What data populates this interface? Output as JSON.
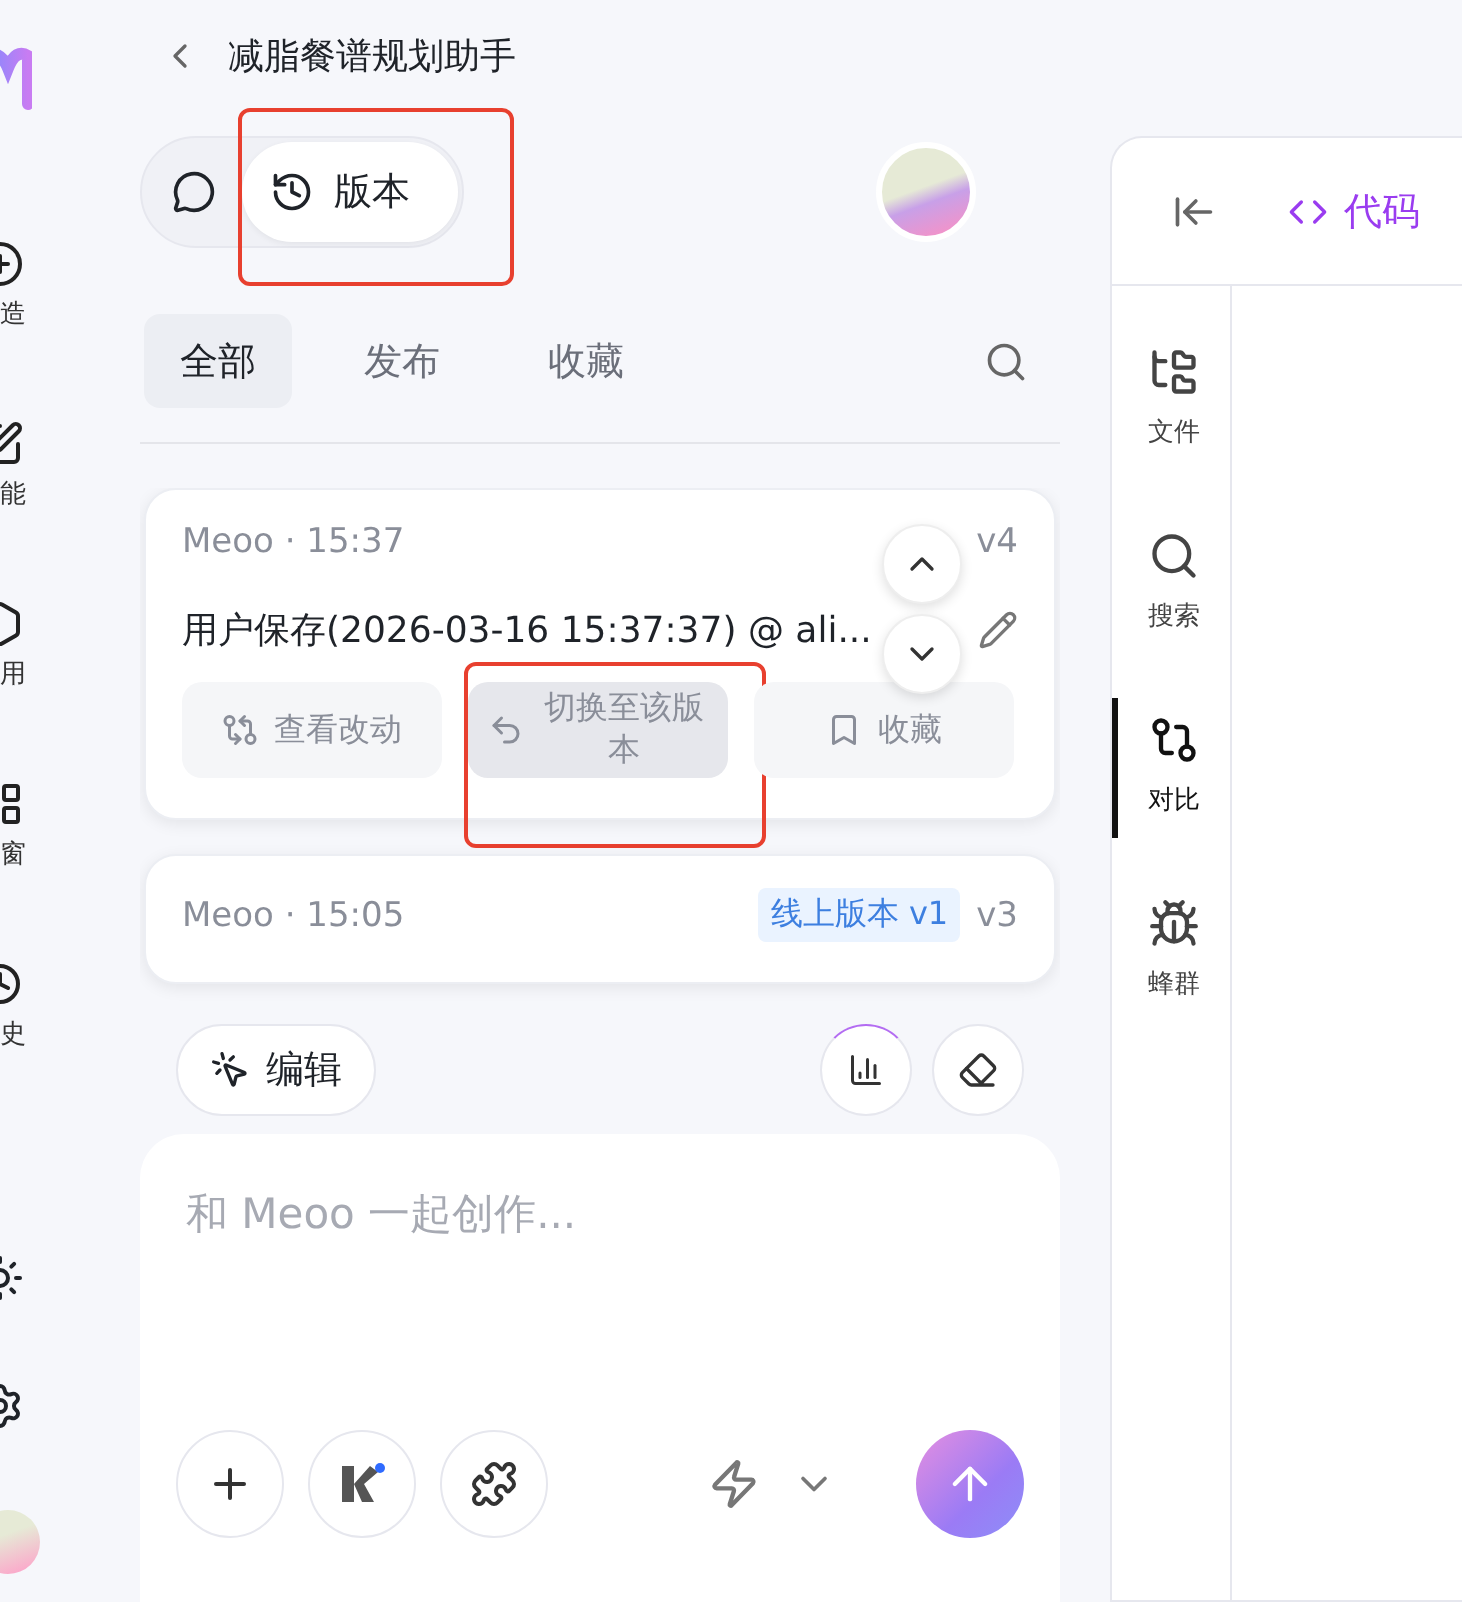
{
  "sidebar": {
    "items": [
      {
        "kind": "create",
        "label": "造"
      },
      {
        "kind": "skills",
        "label": "能"
      },
      {
        "kind": "apps",
        "label": "用"
      },
      {
        "kind": "windows",
        "label": "窗"
      },
      {
        "kind": "history",
        "label": "史"
      }
    ]
  },
  "header": {
    "title": "减脂餐谱规划助手"
  },
  "view_switch": [
    {
      "kind": "chat",
      "selected": false,
      "highlighted": false
    },
    {
      "kind": "versions",
      "label": "版本",
      "selected": true,
      "highlighted": true
    }
  ],
  "filter_tabs": [
    {
      "label": "全部",
      "selected": true
    },
    {
      "label": "发布",
      "selected": false
    },
    {
      "label": "收藏",
      "selected": false
    }
  ],
  "versions": [
    {
      "meta": "Meoo · 15:37",
      "version": "v4",
      "title": "用户保存(2026-03-16 15:37:37) @ ali...",
      "actions": [
        {
          "kind": "diff",
          "label": "查看改动",
          "highlighted": false
        },
        {
          "kind": "restore",
          "label": "切换至该版本",
          "highlighted": true
        },
        {
          "kind": "bookmark",
          "label": "收藏",
          "highlighted": false
        }
      ]
    },
    {
      "meta": "Meoo · 15:05",
      "badge": "线上版本 v1",
      "version": "v3"
    }
  ],
  "toolbar": {
    "edit": "编辑"
  },
  "composer": {
    "placeholder": "和 Meoo 一起创作..."
  },
  "code_panel": {
    "tab": "代码",
    "rail": [
      {
        "kind": "files",
        "label": "文件",
        "selected": false
      },
      {
        "kind": "search",
        "label": "搜索",
        "selected": false
      },
      {
        "kind": "compare",
        "label": "对比",
        "selected": true
      },
      {
        "kind": "swarm",
        "label": "蜂群",
        "selected": false
      }
    ]
  }
}
